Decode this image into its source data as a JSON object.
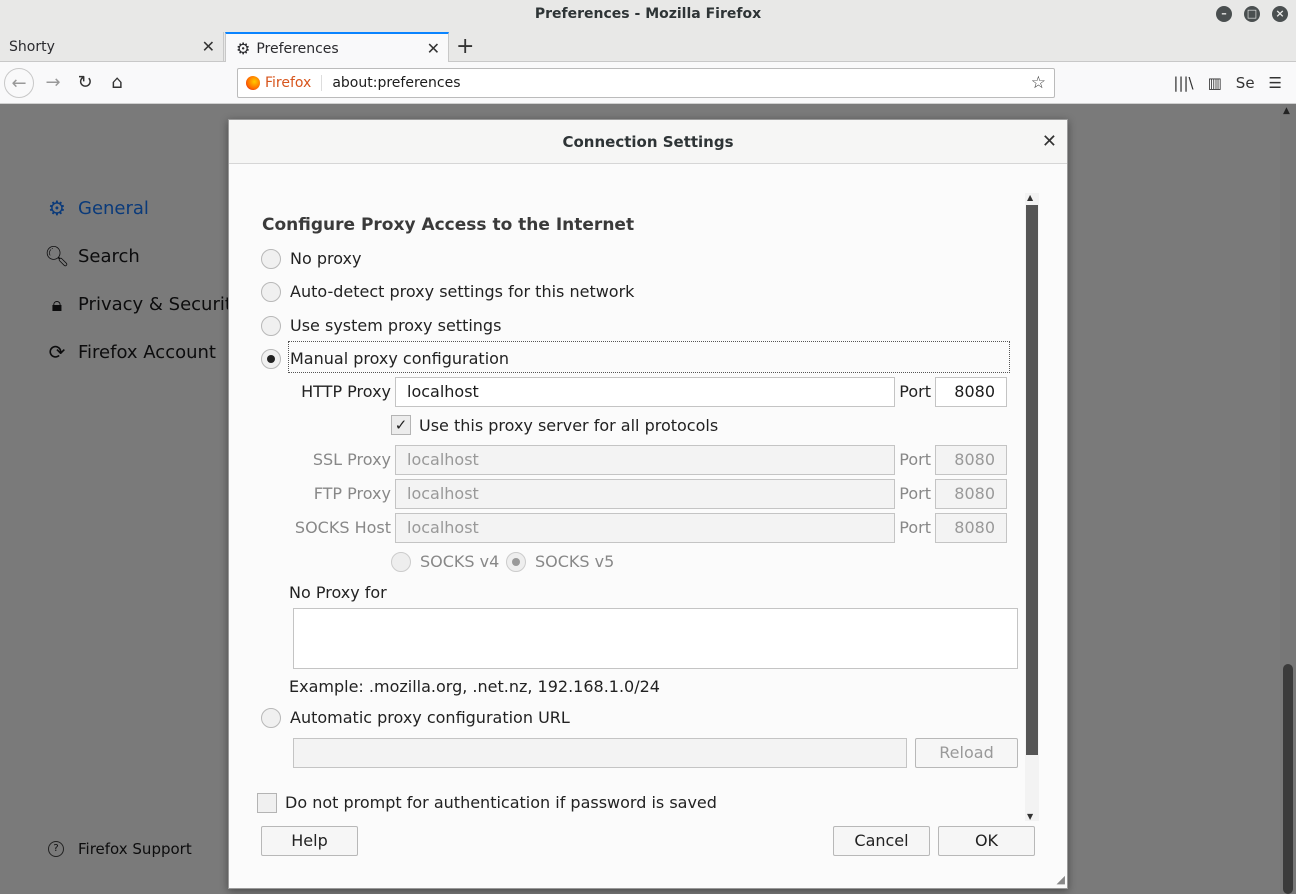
{
  "window": {
    "title": "Preferences - Mozilla Firefox"
  },
  "tabs": [
    {
      "label": "Shorty"
    },
    {
      "label": "Preferences"
    }
  ],
  "urlbar": {
    "identity": "Firefox",
    "url": "about:preferences"
  },
  "sidebar": {
    "items": [
      {
        "label": "General",
        "icon": "gear-icon"
      },
      {
        "label": "Search",
        "icon": "search-icon"
      },
      {
        "label": "Privacy & Security",
        "icon": "lock-icon"
      },
      {
        "label": "Firefox Account",
        "icon": "sync-icon"
      }
    ],
    "support": "Firefox Support"
  },
  "dialog": {
    "title": "Connection Settings",
    "heading": "Configure Proxy Access to the Internet",
    "options": {
      "no_proxy": "No proxy",
      "auto_detect": "Auto-detect proxy settings for this network",
      "system": "Use system proxy settings",
      "manual": "Manual proxy configuration",
      "auto_url": "Automatic proxy configuration URL"
    },
    "selected_option": "manual",
    "http_proxy": {
      "label": "HTTP Proxy",
      "value": "localhost",
      "port_label": "Port",
      "port": "8080"
    },
    "use_for_all": {
      "label": "Use this proxy server for all protocols",
      "checked": true
    },
    "ssl_proxy": {
      "label": "SSL Proxy",
      "value": "localhost",
      "port_label": "Port",
      "port": "8080"
    },
    "ftp_proxy": {
      "label": "FTP Proxy",
      "value": "localhost",
      "port_label": "Port",
      "port": "8080"
    },
    "socks_host": {
      "label": "SOCKS Host",
      "value": "localhost",
      "port_label": "Port",
      "port": "8080"
    },
    "socks_v4": "SOCKS v4",
    "socks_v5": "SOCKS v5",
    "no_proxy_for": {
      "label": "No Proxy for",
      "value": ""
    },
    "example": "Example: .mozilla.org, .net.nz, 192.168.1.0/24",
    "auto_url_value": "",
    "reload": "Reload",
    "no_prompt_auth": {
      "label": "Do not prompt for authentication if password is saved",
      "checked": false
    },
    "buttons": {
      "help": "Help",
      "cancel": "Cancel",
      "ok": "OK"
    }
  }
}
